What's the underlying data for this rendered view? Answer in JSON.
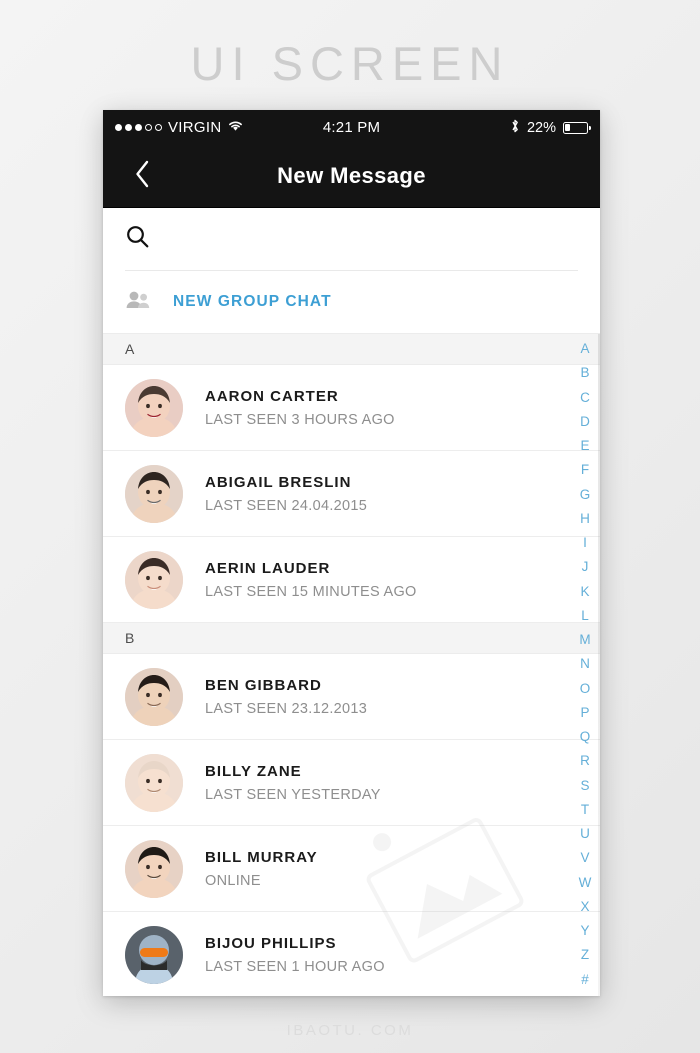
{
  "watermark": {
    "title": "UI SCREEN",
    "footer": "IBAOTU. COM"
  },
  "status_bar": {
    "signal_dots_filled": 3,
    "signal_dots_total": 5,
    "carrier": "VIRGIN",
    "wifi_icon": "wifi-icon",
    "time": "4:21 PM",
    "bluetooth_icon": "bluetooth-icon",
    "battery_percent": "22%",
    "battery_level": 22
  },
  "navbar": {
    "back_icon": "chevron-left-icon",
    "title": "New Message"
  },
  "search": {
    "icon": "search-icon",
    "value": "",
    "placeholder": ""
  },
  "group_chat": {
    "icon": "group-people-icon",
    "label": "NEW GROUP CHAT"
  },
  "sections": [
    {
      "letter": "A",
      "contacts": [
        {
          "name": "AARON CARTER",
          "status": "LAST SEEN 3 HOURS AGO",
          "avatar": "child-girl-avatar"
        },
        {
          "name": "ABIGAIL BRESLIN",
          "status": "LAST SEEN 24.04.2015",
          "avatar": "man-glasses-avatar"
        },
        {
          "name": "AERIN LAUDER",
          "status": "LAST SEEN 15 MINUTES AGO",
          "avatar": "woman-smiling-avatar"
        }
      ]
    },
    {
      "letter": "B",
      "contacts": [
        {
          "name": "BEN GIBBARD",
          "status": "LAST SEEN 23.12.2013",
          "avatar": "man-smiling-avatar"
        },
        {
          "name": "BILLY ZANE",
          "status": "LAST SEEN YESTERDAY",
          "avatar": "woman-face-avatar"
        },
        {
          "name": "BILL MURRAY",
          "status": "ONLINE",
          "avatar": "boy-avatar"
        },
        {
          "name": "BIJOU PHILLIPS",
          "status": "LAST SEEN 1 HOUR AGO",
          "avatar": "skier-avatar"
        }
      ]
    }
  ],
  "index_bar": {
    "letters": [
      "A",
      "B",
      "C",
      "D",
      "E",
      "F",
      "G",
      "H",
      "I",
      "J",
      "K",
      "L",
      "M",
      "N",
      "O",
      "P",
      "Q",
      "R",
      "S",
      "T",
      "U",
      "V",
      "W",
      "X",
      "Y",
      "Z",
      "#"
    ],
    "color": "#64afd8"
  },
  "colors": {
    "accent_blue": "#3d9fd4",
    "navbar_bg": "#141414",
    "section_bg": "#f4f4f4",
    "page_bg": "#eeeeee"
  }
}
